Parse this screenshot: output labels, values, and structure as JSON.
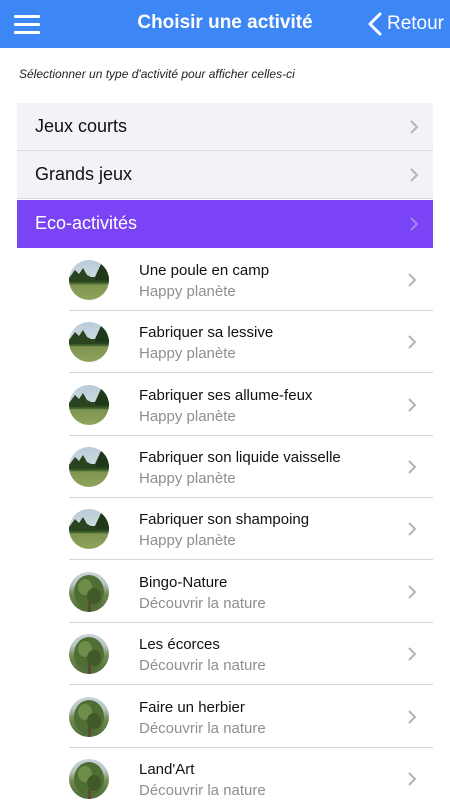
{
  "header": {
    "title": "Choisir une activité",
    "back_label": "Retour",
    "color": "#3d86f5"
  },
  "intro": "Sélectionner un type d'activité pour afficher celles-ci",
  "categories": [
    {
      "label": "Jeux courts",
      "active": false
    },
    {
      "label": "Grands jeux",
      "active": false
    },
    {
      "label": "Eco-activités",
      "active": true,
      "color": "#7a43f5"
    }
  ],
  "activities": [
    {
      "title": "Une poule en camp",
      "subtitle": "Happy planète",
      "thumb": "meadow-image"
    },
    {
      "title": "Fabriquer sa lessive",
      "subtitle": "Happy planète",
      "thumb": "meadow-image"
    },
    {
      "title": "Fabriquer ses allume-feux",
      "subtitle": "Happy planète",
      "thumb": "meadow-image"
    },
    {
      "title": "Fabriquer son liquide vaisselle",
      "subtitle": "Happy planète",
      "thumb": "meadow-image"
    },
    {
      "title": "Fabriquer son shampoing",
      "subtitle": "Happy planète",
      "thumb": "meadow-image"
    },
    {
      "title": "Bingo-Nature",
      "subtitle": "Découvrir la nature",
      "thumb": "tree-image"
    },
    {
      "title": "Les écorces",
      "subtitle": "Découvrir la nature",
      "thumb": "tree-image"
    },
    {
      "title": "Faire un herbier",
      "subtitle": "Découvrir la nature",
      "thumb": "tree-image"
    },
    {
      "title": "Land'Art",
      "subtitle": "Découvrir la nature",
      "thumb": "tree-image"
    }
  ]
}
